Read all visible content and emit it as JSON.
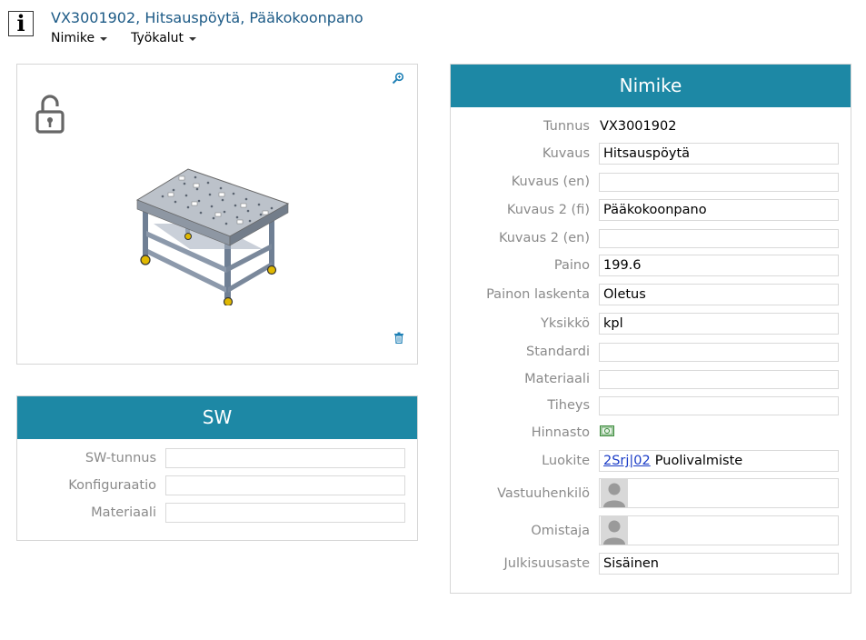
{
  "header": {
    "title": "VX3001902, Hitsauspöytä, Pääkokoonpano",
    "info_icon_glyph": "i",
    "menus": [
      "Nimike",
      "Työkalut"
    ]
  },
  "icons": {
    "info": "info-icon",
    "zoom": "zoom-icon",
    "lock": "unlock-icon",
    "delete": "trash-icon",
    "pricelist": "money-icon",
    "person": "user-placeholder-icon",
    "dropdown": "chevron-down-icon"
  },
  "colors": {
    "header_bg": "#1d88a5",
    "title_text": "#1c5a86",
    "label_text": "#8a8a8a",
    "link": "#1a3cc7"
  },
  "sw_panel": {
    "title": "SW",
    "fields": [
      {
        "label": "SW-tunnus",
        "value": ""
      },
      {
        "label": "Konfiguraatio",
        "value": ""
      },
      {
        "label": "Materiaali",
        "value": ""
      }
    ]
  },
  "nimike_panel": {
    "title": "Nimike",
    "tunnus": {
      "label": "Tunnus",
      "value": "VX3001902"
    },
    "kuvaus": {
      "label": "Kuvaus",
      "value": "Hitsauspöytä"
    },
    "kuvaus_en": {
      "label": "Kuvaus (en)",
      "value": ""
    },
    "kuvaus2_fi": {
      "label": "Kuvaus 2 (fi)",
      "value": "Pääkokoonpano"
    },
    "kuvaus2_en": {
      "label": "Kuvaus 2 (en)",
      "value": ""
    },
    "paino": {
      "label": "Paino",
      "value": "199.6"
    },
    "painon_laskenta": {
      "label": "Painon laskenta",
      "value": "Oletus"
    },
    "yksikko": {
      "label": "Yksikkö",
      "value": "kpl"
    },
    "standardi": {
      "label": "Standardi",
      "value": ""
    },
    "materiaali": {
      "label": "Materiaali",
      "value": ""
    },
    "tiheys": {
      "label": "Tiheys",
      "value": ""
    },
    "hinnasto": {
      "label": "Hinnasto"
    },
    "luokite": {
      "label": "Luokite",
      "link": "2Srj|02",
      "value": "Puolivalmiste"
    },
    "vastuuhenkilo": {
      "label": "Vastuuhenkilö"
    },
    "omistaja": {
      "label": "Omistaja"
    },
    "julkisuusaste": {
      "label": "Julkisuusaste",
      "value": "Sisäinen"
    }
  }
}
